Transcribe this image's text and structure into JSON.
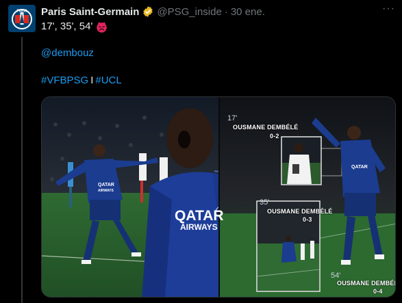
{
  "tweet": {
    "author_name": "Paris Saint-Germain",
    "handle": "@PSG_inside",
    "separator": "·",
    "timestamp": "30 ene.",
    "more_icon": "more-dots-icon",
    "avatar_icon": "psg-crest-icon",
    "avatar_text": "PARIS",
    "verified_icon": "verified-gold-badge-icon",
    "line1": "17', 35', 54'",
    "line1_emoji": "red-face-emoji-icon",
    "mention": "@dembouz",
    "hashtag1": "#VFBPSG",
    "hashtag_separator": "I",
    "hashtag2": "#UCL"
  },
  "media": {
    "sponsor_big": "QATAR",
    "sponsor_big_2": "AIRWAYS",
    "sponsor_small": "QATAR",
    "sponsor_small_2": "AIRWAYS",
    "goals": [
      {
        "minute": "17'",
        "player": "OUSMANE DEMBÉLÉ",
        "score": "0-2"
      },
      {
        "minute": "35'",
        "player": "OUSMANE DEMBÉLÉ",
        "score": "0-3"
      },
      {
        "minute": "54'",
        "player": "OUSMANE DEMBÉLÉ",
        "score": "0-4"
      }
    ]
  },
  "colors": {
    "background": "#000000",
    "text": "#e7e9ea",
    "muted": "#71767b",
    "link": "#1d9bf0",
    "verified": "#e8b923",
    "psg_navy": "#004170"
  }
}
